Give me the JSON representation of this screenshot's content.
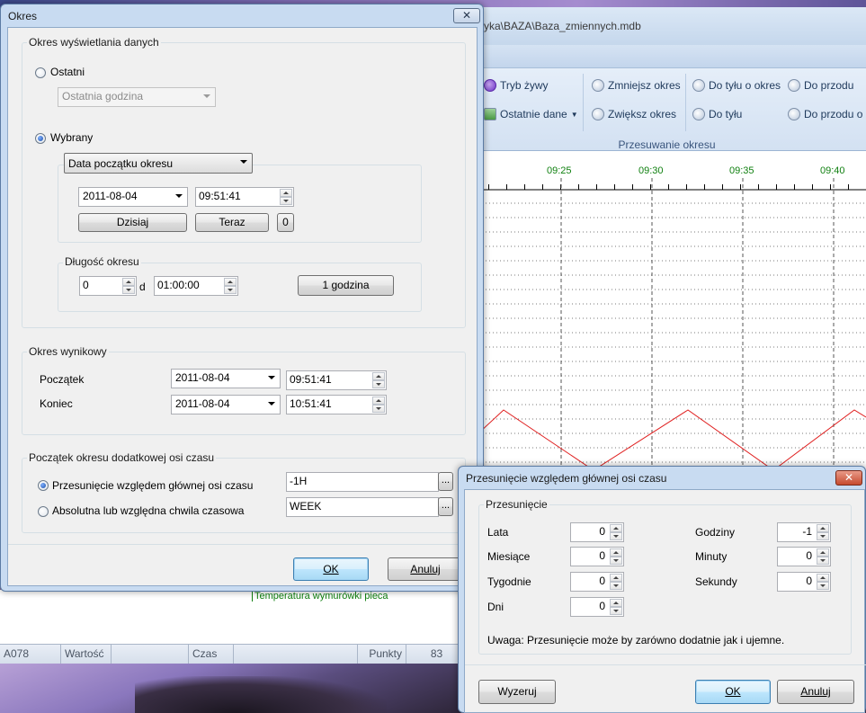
{
  "app": {
    "title_path": "yka\\BAZA\\Baza_zmiennych.mdb",
    "ribbon": {
      "tryb_zywy": "Tryb żywy",
      "ostatnie_dane": "Ostatnie dane",
      "zmniejsz_okres": "Zmniejsz okres",
      "zwieksz_okres": "Zwiększ okres",
      "do_tylu_o_okres": "Do tyłu o okres",
      "do_tylu": "Do tyłu",
      "do_przodu": "Do przodu",
      "do_przodu_o": "Do przodu o",
      "group_label": "Przesuwanie okresu"
    },
    "chart": {
      "time_ticks": [
        "09:25",
        "09:30",
        "09:35",
        "09:40"
      ],
      "legend_label": "Temperatura wymurówki pieca",
      "line_color": "#e02020",
      "tick_color": "#108010"
    },
    "statusbar": {
      "tag": "A078",
      "value_label": "Wartość",
      "time_label": "Czas",
      "points_label": "Punkty",
      "points_value": "83"
    }
  },
  "dialog_okres": {
    "title": "Okres",
    "close_symbol": "✕",
    "group_display": {
      "legend": "Okres wyświetlania danych",
      "radio_ostatni": "Ostatni",
      "ostatni_combo_value": "Ostatnia godzina",
      "radio_wybrany": "Wybrany",
      "mode_combo_value": "Data początku okresu",
      "start_date": "2011-08-04",
      "start_time": "09:51:41",
      "btn_dzisiaj": "Dzisiaj",
      "btn_teraz": "Teraz",
      "btn_zero": "0",
      "length_legend": "Długość okresu",
      "length_days": "0",
      "length_days_unit": "d",
      "length_time": "01:00:00",
      "btn_1godzina": "1 godzina"
    },
    "group_result": {
      "legend": "Okres wynikowy",
      "start_label": "Początek",
      "start_date": "2011-08-04",
      "start_time": "09:51:41",
      "end_label": "Koniec",
      "end_date": "2011-08-04",
      "end_time": "10:51:41"
    },
    "group_extra_axis": {
      "legend": "Początek okresu dodatkowej osi czasu",
      "radio_shift": "Przesunięcie względem głównej osi czasu",
      "shift_value": "-1H",
      "radio_absolute": "Absolutna lub względna chwila czasowa",
      "absolute_value": "WEEK",
      "browse_label": "..."
    },
    "ok_label": "OK",
    "cancel_label": "Anuluj"
  },
  "dialog_shift": {
    "title": "Przesunięcie względem głównej osi czasu",
    "close_symbol": "✕",
    "group_legend": "Przesunięcie",
    "fields": {
      "lata": {
        "label": "Lata",
        "value": "0"
      },
      "miesiace": {
        "label": "Miesiące",
        "value": "0"
      },
      "tygodnie": {
        "label": "Tygodnie",
        "value": "0"
      },
      "dni": {
        "label": "Dni",
        "value": "0"
      },
      "godziny": {
        "label": "Godziny",
        "value": "-1"
      },
      "minuty": {
        "label": "Minuty",
        "value": "0"
      },
      "sekundy": {
        "label": "Sekundy",
        "value": "0"
      }
    },
    "note": "Uwaga: Przesunięcie może by zarówno dodatnie jak i ujemne.",
    "reset_label": "Wyzeruj",
    "ok_label": "OK",
    "cancel_label": "Anuluj"
  }
}
